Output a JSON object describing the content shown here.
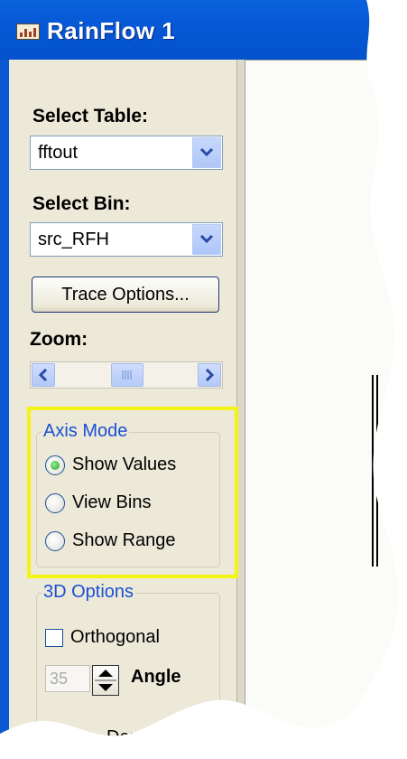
{
  "window": {
    "title": "RainFlow 1"
  },
  "icons": {
    "app": "chart-icon",
    "dropdown": "chevron-down-icon",
    "scroll_left": "chevron-left-icon",
    "scroll_right": "chevron-right-icon",
    "scroll_thumb": "grip-icon",
    "spinner": "spinner-arrows-icon"
  },
  "colors": {
    "titlebar": "#0452cc",
    "panel": "#ece9d8",
    "group_title": "#1a4fd6",
    "highlight": "#f3f316"
  },
  "controls": {
    "select_table": {
      "label": "Select Table:",
      "value": "fftout"
    },
    "select_bin": {
      "label": "Select Bin:",
      "value": "src_RFH"
    },
    "trace_options": {
      "label": "Trace Options..."
    },
    "zoom": {
      "label": "Zoom:",
      "level": 0.5
    }
  },
  "axis_mode": {
    "title": "Axis Mode",
    "options": [
      {
        "label": "Show Values",
        "selected": true
      },
      {
        "label": "View Bins",
        "selected": false
      },
      {
        "label": "Show Range",
        "selected": false
      }
    ]
  },
  "options_3d": {
    "title": "3D Options",
    "orthogonal": {
      "label": "Orthogonal",
      "checked": false
    },
    "angle": {
      "label": "Angle",
      "value": "35"
    },
    "depth": {
      "label": "Depth"
    }
  }
}
